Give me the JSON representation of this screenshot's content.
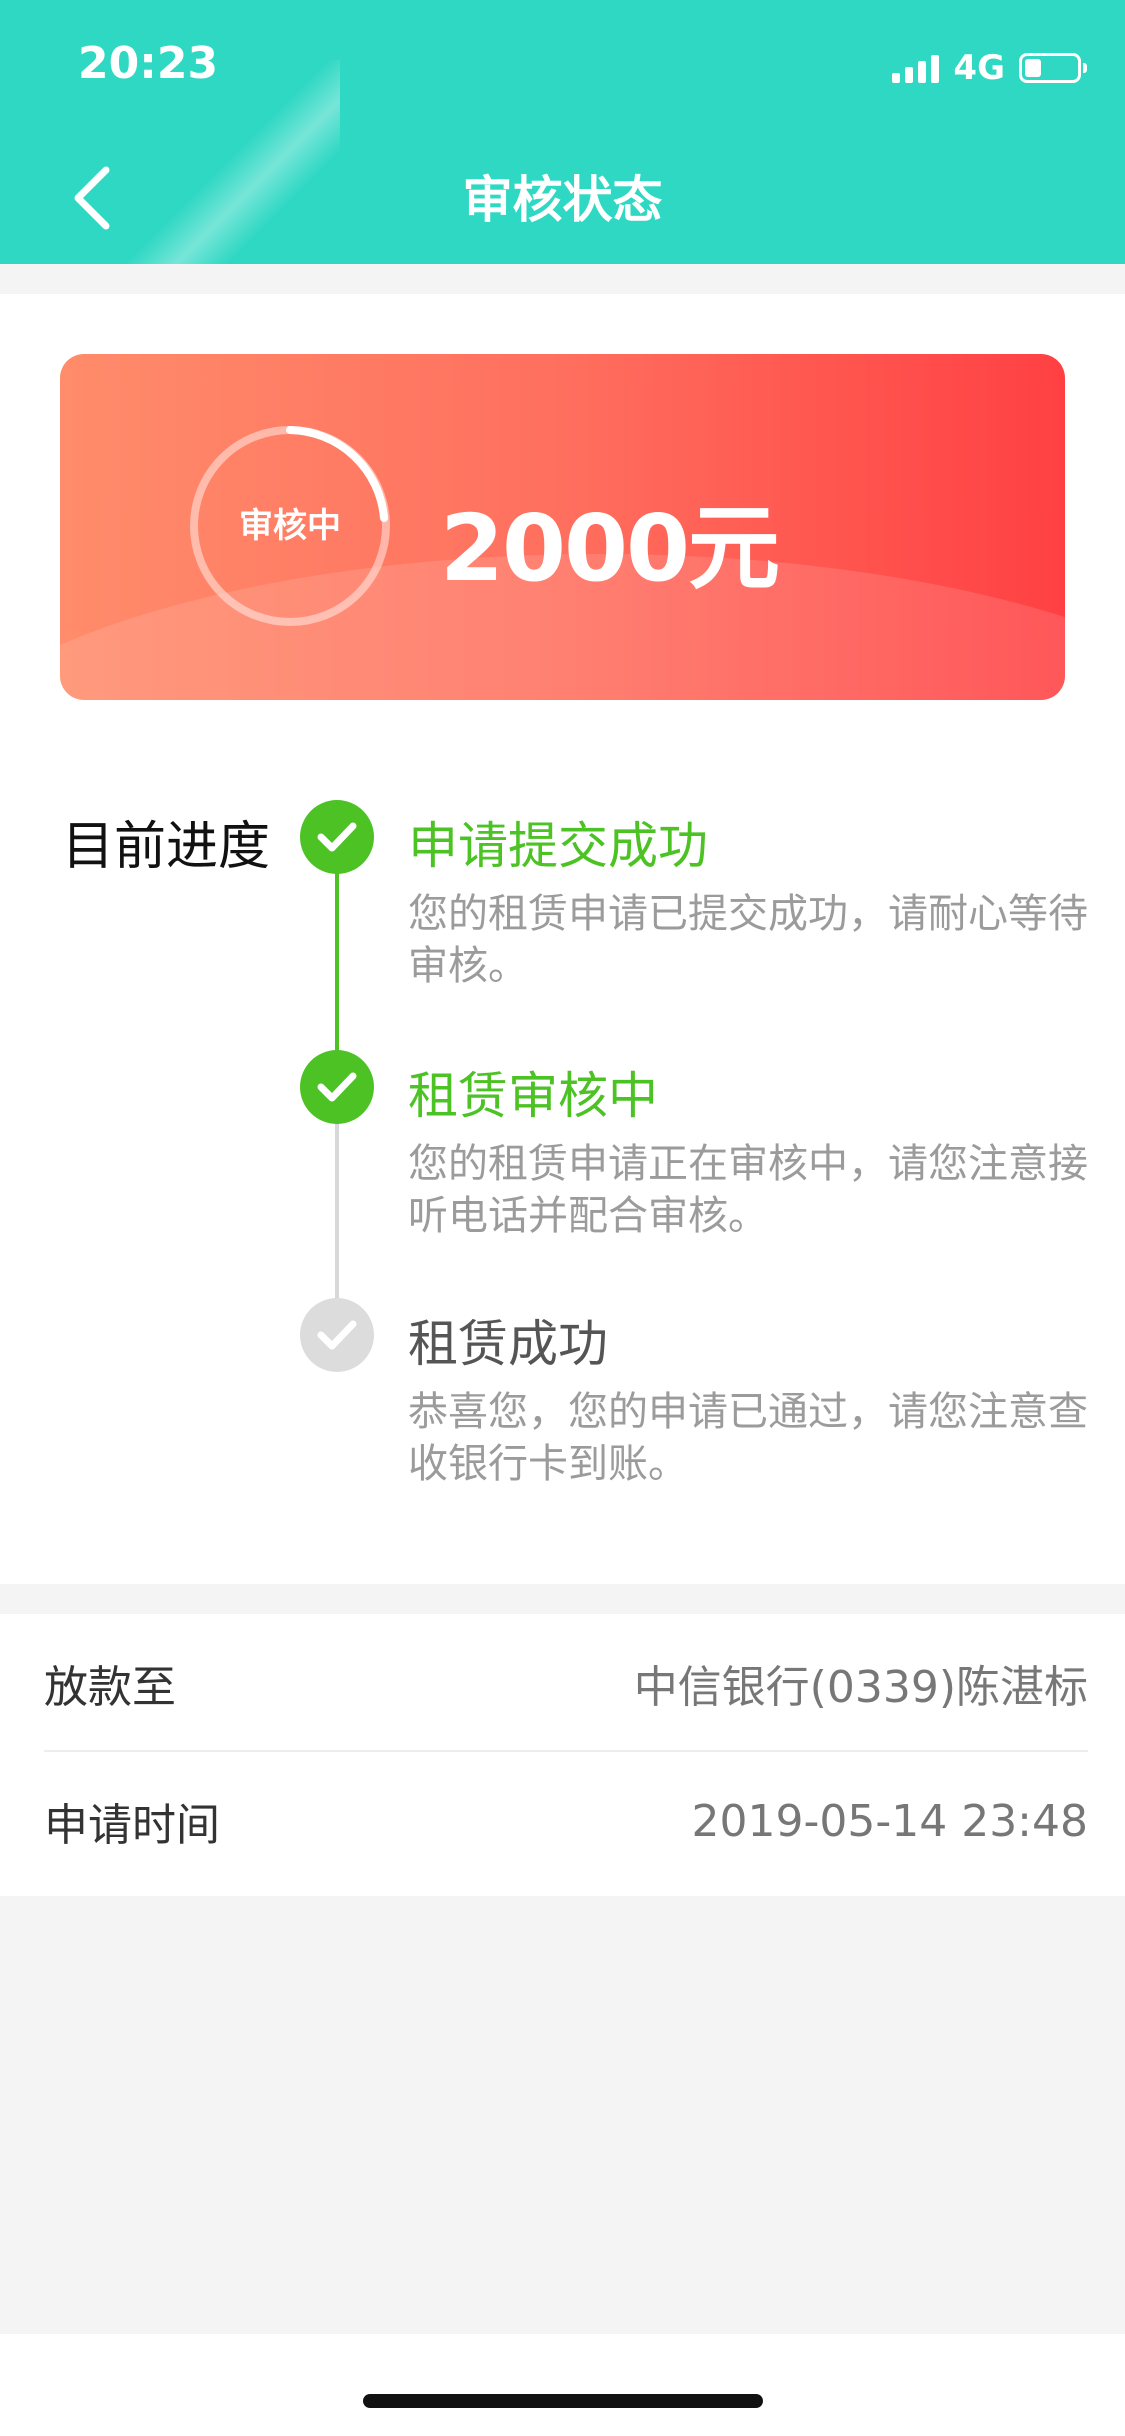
{
  "status_bar": {
    "time": "20:23",
    "network": "4G",
    "battery_level_fraction": 0.25
  },
  "header": {
    "title": "审核状态",
    "back_icon": "chevron-left-icon"
  },
  "banner": {
    "status": "审核中",
    "amount": "2000元",
    "gradient_colors": [
      "#ff8c6b",
      "#ff4043"
    ]
  },
  "progress": {
    "label": "目前进度",
    "steps": [
      {
        "title": "申请提交成功",
        "description": "您的租赁申请已提交成功，请耐心等待审核。",
        "state": "done"
      },
      {
        "title": "租赁审核中",
        "description": "您的租赁申请正在审核中，请您注意接听电话并配合审核。",
        "state": "done"
      },
      {
        "title": "租赁成功",
        "description": "恭喜您，您的申请已通过，请您注意查收银行卡到账。",
        "state": "pending"
      }
    ]
  },
  "info": {
    "rows": [
      {
        "label": "放款至",
        "value": "中信银行(0339)陈湛标"
      },
      {
        "label": "申请时间",
        "value": "2019-05-14 23:48"
      }
    ]
  },
  "colors": {
    "header_bg": "#2ed8c3",
    "done_green": "#4cc224",
    "pending_gray": "#dcdcdc"
  }
}
